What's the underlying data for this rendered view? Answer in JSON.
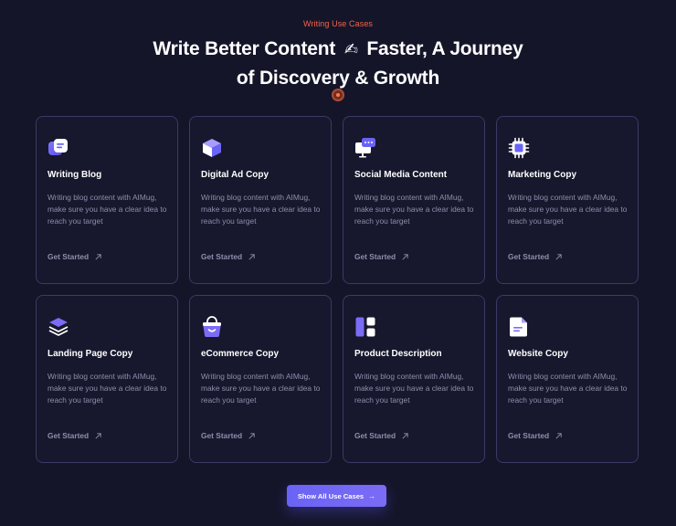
{
  "header": {
    "eyebrow": "Writing Use Cases",
    "headline_line1_a": "Write Better Content",
    "headline_emoji": "✍",
    "headline_line1_b": "Faster, A Journey",
    "headline_line2": "of Discovery & Growth"
  },
  "cards": [
    {
      "title": "Writing Blog",
      "icon": "chat-bubbles-icon",
      "desc": "Writing blog content with AIMug, make sure you have a clear idea to reach you target",
      "cta": "Get Started"
    },
    {
      "title": "Digital Ad Copy",
      "icon": "cube-icon",
      "desc": "Writing blog content with AIMug, make sure you have a clear idea to reach you target",
      "cta": "Get Started"
    },
    {
      "title": "Social Media Content",
      "icon": "presentation-chat-icon",
      "desc": "Writing blog content with AIMug, make sure you have a clear idea to reach you target",
      "cta": "Get Started"
    },
    {
      "title": "Marketing Copy",
      "icon": "chip-icon",
      "desc": "Writing blog content with AIMug, make sure you have a clear idea to reach you target",
      "cta": "Get Started"
    },
    {
      "title": "Landing Page Copy",
      "icon": "layers-icon",
      "desc": "Writing blog content with AIMug, make sure you have a clear idea to reach you target",
      "cta": "Get Started"
    },
    {
      "title": "eCommerce Copy",
      "icon": "shopping-bag-icon",
      "desc": "Writing blog content with AIMug, make sure you have a clear idea to reach you target",
      "cta": "Get Started"
    },
    {
      "title": "Product Description",
      "icon": "layout-columns-icon",
      "desc": "Writing blog content with AIMug, make sure you have a clear idea to reach you target",
      "cta": "Get Started"
    },
    {
      "title": "Website Copy",
      "icon": "document-icon",
      "desc": "Writing blog content with AIMug, make sure you have a clear idea to reach you target",
      "cta": "Get Started"
    }
  ],
  "show_all": {
    "label": "Show All Use Cases",
    "arrow": "→"
  },
  "colors": {
    "background": "#15152a",
    "eyebrow": "#f0654a",
    "card_border": "#3a3a66",
    "accent": "#6a63f5",
    "muted_text": "#8f8fae"
  }
}
